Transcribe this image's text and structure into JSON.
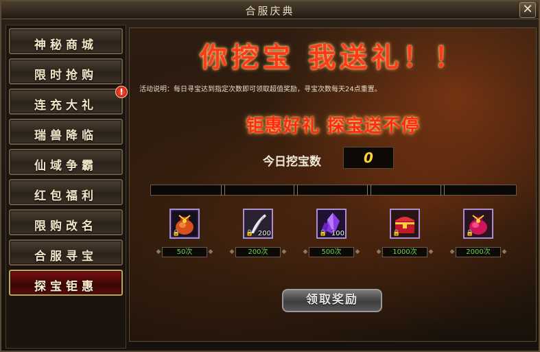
{
  "window": {
    "title": "合服庆典",
    "close_label": "✕"
  },
  "sidebar": {
    "items": [
      {
        "label": "神秘商城"
      },
      {
        "label": "限时抢购"
      },
      {
        "label": "连充大礼",
        "badge": "!"
      },
      {
        "label": "瑞兽降临"
      },
      {
        "label": "仙域争霸"
      },
      {
        "label": "红包福利"
      },
      {
        "label": "限购改名"
      },
      {
        "label": "合服寻宝"
      },
      {
        "label": "探宝钜惠",
        "active": true
      }
    ]
  },
  "main": {
    "banner": "你挖宝 我送礼！！",
    "description": "活动说明：每日寻宝达到指定次数即可领取超值奖励，寻宝次数每天24点重置。",
    "subbanner": "钜惠好礼 探宝送不停",
    "count_label": "今日挖宝数",
    "count_value": "0",
    "rewards": [
      {
        "icon": "orange-bag-icon",
        "qty": "",
        "requirement": "50次"
      },
      {
        "icon": "white-feather-icon",
        "qty": "200",
        "requirement": "200次"
      },
      {
        "icon": "purple-crystal-icon",
        "qty": "100",
        "requirement": "500次"
      },
      {
        "icon": "red-chest-icon",
        "qty": "",
        "requirement": "1000次"
      },
      {
        "icon": "red-bag-icon",
        "qty": "",
        "requirement": "2000次"
      }
    ],
    "claim_button": "领取奖励"
  },
  "colors": {
    "accent_red": "#ff2a10",
    "gold": "#ffd23a",
    "requirement_green": "#6ed44a"
  }
}
